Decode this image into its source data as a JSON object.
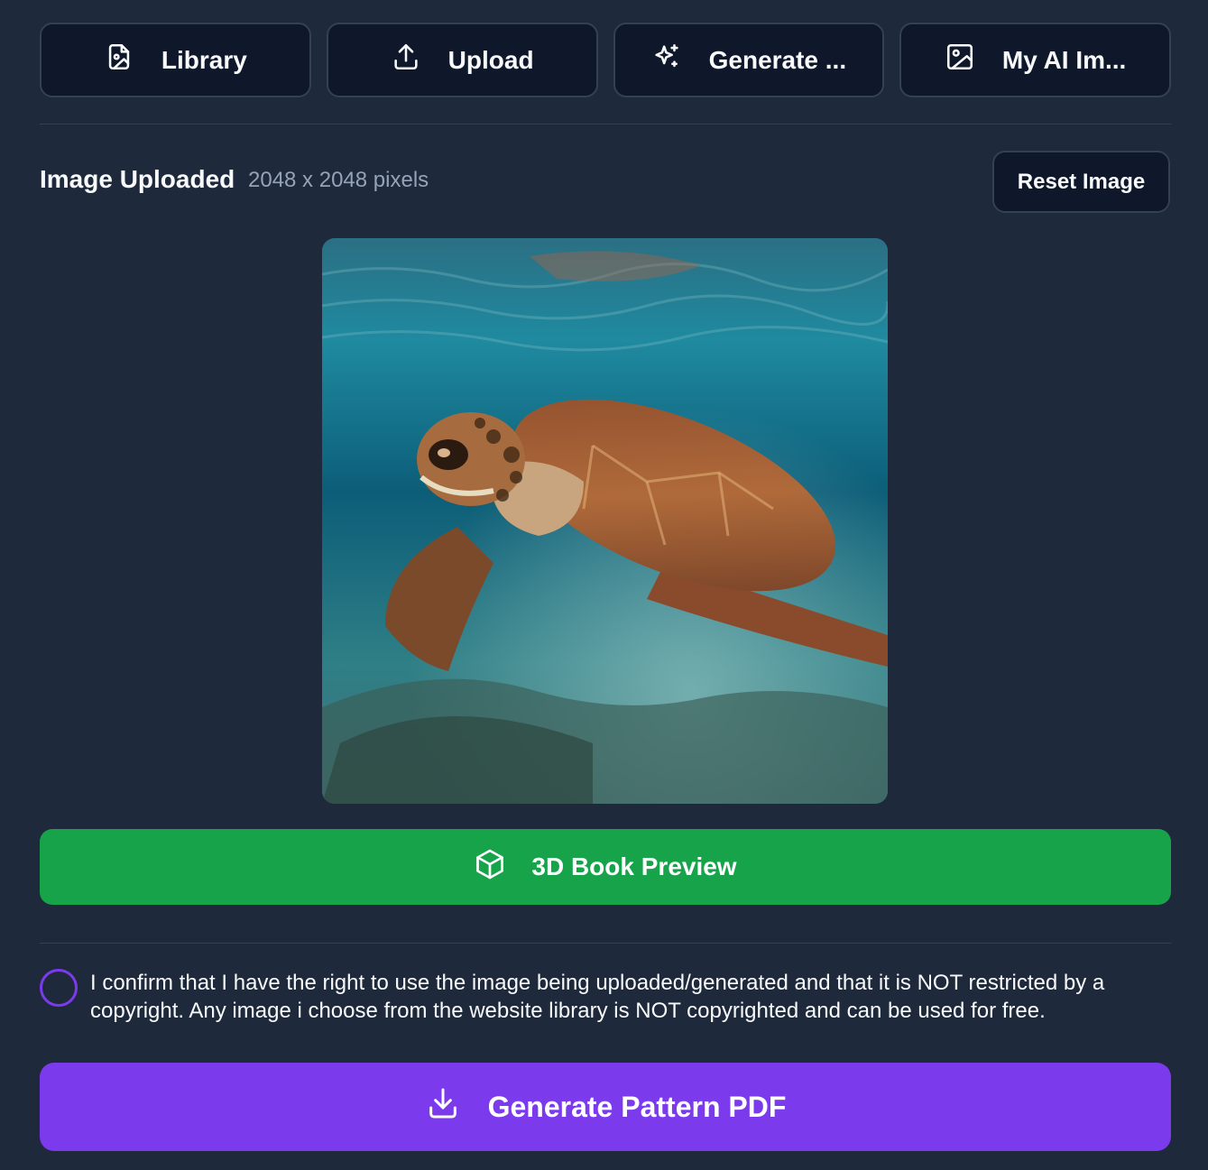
{
  "tabs": [
    {
      "label": "Library",
      "icon": "file-image-icon"
    },
    {
      "label": "Upload",
      "icon": "upload-icon"
    },
    {
      "label": "Generate ...",
      "icon": "sparkles-icon"
    },
    {
      "label": "My AI Im...",
      "icon": "image-icon"
    }
  ],
  "header": {
    "title": "Image Uploaded",
    "dimensions": "2048 x 2048 pixels",
    "reset_label": "Reset Image"
  },
  "image": {
    "subject": "sea turtle swimming underwater",
    "icon": "uploaded-image"
  },
  "preview_button": {
    "label": "3D Book Preview",
    "icon": "cube-icon",
    "color": "#16a34a"
  },
  "consent": {
    "checked": false,
    "text": "I confirm that I have the right to use the image being uploaded/generated and that it is NOT restricted by a copyright. Any image i choose from the website library is NOT copyrighted and can be used for free."
  },
  "pdf_button": {
    "label": "Generate Pattern PDF",
    "icon": "download-icon",
    "color": "#7c3aed"
  },
  "colors": {
    "background": "#1e293b",
    "tab_background": "#0f172a",
    "border": "#334155",
    "muted_text": "#94a3b8",
    "checkbox_accent": "#7c3aed"
  }
}
